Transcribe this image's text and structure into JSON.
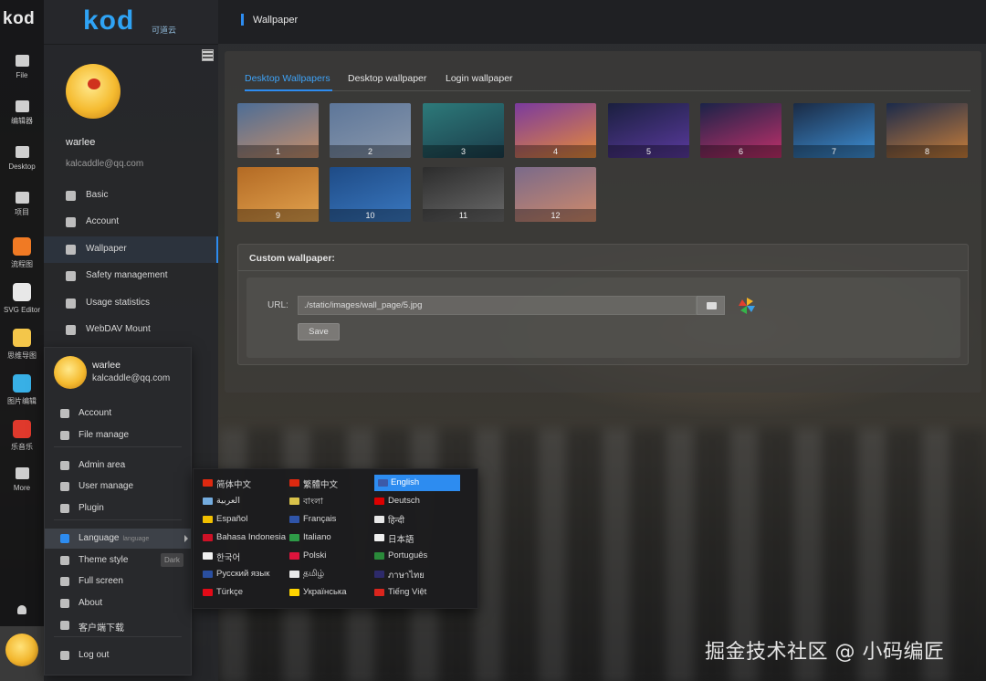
{
  "rail": {
    "logo": "kod",
    "items": [
      {
        "label": "File",
        "icon": "folder-icon"
      },
      {
        "label": "编辑器",
        "icon": "edit-icon"
      },
      {
        "label": "Desktop",
        "icon": "monitor-icon"
      },
      {
        "label": "项目",
        "icon": "checkbox-icon"
      },
      {
        "label": "流程图",
        "icon": "flowchart-icon",
        "color": "#f07a24"
      },
      {
        "label": "SVG Editor",
        "icon": "svg-editor-icon",
        "color": "#e8e8e8"
      },
      {
        "label": "思维导图",
        "icon": "mindmap-icon",
        "color": "#f4c64a"
      },
      {
        "label": "图片编辑",
        "icon": "image-edit-icon",
        "color": "#38b0e6"
      },
      {
        "label": "乐音乐",
        "icon": "music-icon",
        "color": "#e0392c"
      },
      {
        "label": "More",
        "icon": "grid-icon"
      }
    ]
  },
  "sidebar": {
    "logo": "kod",
    "logo_sub": "可道云",
    "user_name": "warlee",
    "user_email": "kalcaddle@qq.com",
    "items": [
      {
        "label": "Basic",
        "icon": "gear-icon"
      },
      {
        "label": "Account",
        "icon": "user-circle-icon"
      },
      {
        "label": "Wallpaper",
        "icon": "image-icon"
      },
      {
        "label": "Safety management",
        "icon": "shield-icon"
      },
      {
        "label": "Usage statistics",
        "icon": "bar-chart-icon"
      },
      {
        "label": "WebDAV Mount",
        "icon": "drive-icon"
      }
    ]
  },
  "topbar": {
    "title": "Wallpaper"
  },
  "main": {
    "tabs": [
      {
        "label": "Desktop Wallpapers",
        "active": true
      },
      {
        "label": "Desktop wallpaper",
        "active": false
      },
      {
        "label": "Login wallpaper",
        "active": false
      }
    ],
    "wallpapers": [
      {
        "n": "1",
        "colors": [
          "#4d6d96",
          "#c58e6a"
        ]
      },
      {
        "n": "2",
        "colors": [
          "#5d7699",
          "#8a98ac"
        ]
      },
      {
        "n": "3",
        "colors": [
          "#2d7a7a",
          "#1b3c4a"
        ]
      },
      {
        "n": "4",
        "colors": [
          "#7a3a9e",
          "#e68a3a"
        ]
      },
      {
        "n": "5",
        "colors": [
          "#1a1f3e",
          "#5a3a9e"
        ]
      },
      {
        "n": "6",
        "colors": [
          "#1b2348",
          "#c0306a"
        ]
      },
      {
        "n": "7",
        "colors": [
          "#1a2a44",
          "#3e90d6"
        ]
      },
      {
        "n": "8",
        "colors": [
          "#1b2a4a",
          "#c87e3a"
        ]
      },
      {
        "n": "9",
        "colors": [
          "#b36a24",
          "#e2a24e"
        ]
      },
      {
        "n": "10",
        "colors": [
          "#1e4b86",
          "#3a78c0"
        ]
      },
      {
        "n": "11",
        "colors": [
          "#2c2c2c",
          "#6a6a6a"
        ]
      },
      {
        "n": "12",
        "colors": [
          "#7a6a8a",
          "#d08a6a"
        ]
      }
    ],
    "custom": {
      "title": "Custom wallpaper:",
      "url_label": "URL:",
      "url_value": "./static/images/wall_page/5.jpg",
      "save_label": "Save"
    }
  },
  "user_menu": {
    "name": "warlee",
    "email": "kalcaddle@qq.com",
    "items": [
      {
        "label": "Account",
        "icon": "user-circle-icon"
      },
      {
        "label": "File manage",
        "icon": "folder-icon"
      },
      {
        "label": "Admin area",
        "icon": "bar-chart-icon"
      },
      {
        "label": "User manage",
        "icon": "users-icon"
      },
      {
        "label": "Plugin",
        "icon": "plugin-icon"
      },
      {
        "label": "Language",
        "sub": "language",
        "icon": "flag-icon"
      },
      {
        "label": "Theme style",
        "badge": "Dark",
        "icon": "shirt-icon"
      },
      {
        "label": "Full screen",
        "icon": "fullscreen-icon"
      },
      {
        "label": "About",
        "icon": "info-icon"
      },
      {
        "label": "客户端下载",
        "icon": "download-icon"
      },
      {
        "label": "Log out",
        "icon": "logout-icon"
      }
    ]
  },
  "languages": [
    {
      "label": "简体中文",
      "flag": "#de2910"
    },
    {
      "label": "繁體中文",
      "flag": "#de2910"
    },
    {
      "label": "English",
      "flag": "#3c5aa8",
      "selected": true
    },
    {
      "label": "العربية",
      "flag": "#74acdf"
    },
    {
      "label": "বাংলা",
      "flag": "#d9c24a"
    },
    {
      "label": "Deutsch",
      "flag": "#dd0000"
    },
    {
      "label": "Español",
      "flag": "#f1bf00"
    },
    {
      "label": "Français",
      "flag": "#2f54a8"
    },
    {
      "label": "हिन्दी",
      "flag": "#e8e8e8"
    },
    {
      "label": "Bahasa Indonesia",
      "flag": "#ce1126"
    },
    {
      "label": "Italiano",
      "flag": "#2e9b47"
    },
    {
      "label": "日本語",
      "flag": "#f0f0f0"
    },
    {
      "label": "한국어",
      "flag": "#f0f0f0"
    },
    {
      "label": "Polski",
      "flag": "#dc143c"
    },
    {
      "label": "Português",
      "flag": "#2a8a3a"
    },
    {
      "label": "Русский язык",
      "flag": "#2a4fa0"
    },
    {
      "label": "தமிழ்",
      "flag": "#e8e8e8"
    },
    {
      "label": "ภาษาไทย",
      "flag": "#2d2a6a"
    },
    {
      "label": "Türkçe",
      "flag": "#e30a17"
    },
    {
      "label": "Українська",
      "flag": "#ffd500"
    },
    {
      "label": "Tiếng Việt",
      "flag": "#da251d"
    }
  ],
  "watermark": "掘金技术社区 @ 小码编匠"
}
